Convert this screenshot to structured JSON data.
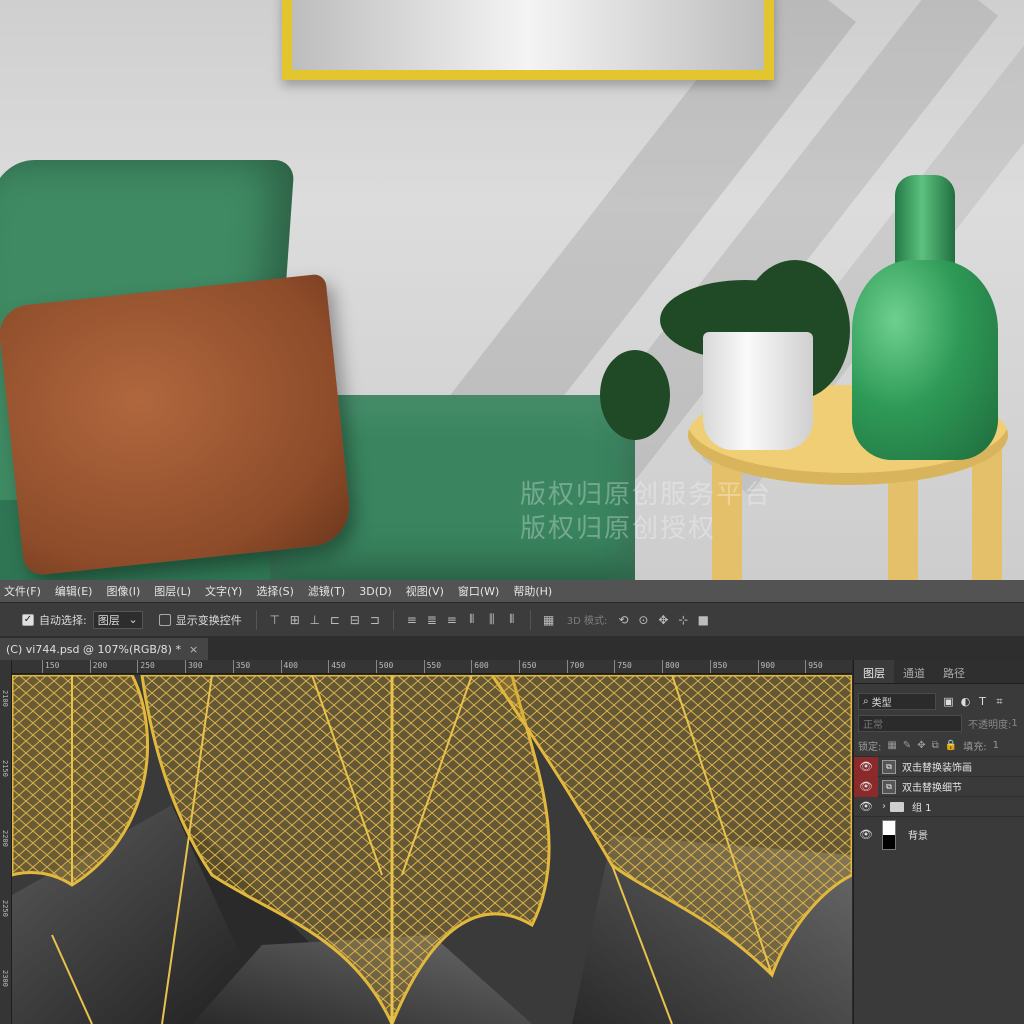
{
  "menu": [
    "文件(F)",
    "编辑(E)",
    "图像(I)",
    "图层(L)",
    "文字(Y)",
    "选择(S)",
    "滤镜(T)",
    "3D(D)",
    "视图(V)",
    "窗口(W)",
    "帮助(H)"
  ],
  "options": {
    "auto_select_label": "自动选择:",
    "auto_select_value": "图层",
    "show_transform_label": "显示变换控件",
    "mode_3d_label": "3D 模式:"
  },
  "document_tab": {
    "title": "(C) vi744.psd @ 107%(RGB/8) *",
    "close": "×"
  },
  "ruler": {
    "h_labels": [
      "150",
      "200",
      "250",
      "300",
      "350",
      "400",
      "450",
      "500",
      "550",
      "600",
      "650",
      "700",
      "750",
      "800",
      "850",
      "900",
      "950"
    ],
    "v_labels": [
      "2100",
      "2150",
      "2200",
      "2250",
      "2300"
    ]
  },
  "watermark": [
    "版权归原创服务平台",
    "版权归原创授权"
  ],
  "layers_panel": {
    "tabs": [
      "图层",
      "通道",
      "路径"
    ],
    "filter": "类型",
    "blend_mode": "正常",
    "opacity_label": "不透明度:",
    "opacity_value": "1",
    "lock_label": "锁定:",
    "fill_label": "填充:",
    "fill_value": "1",
    "layers": [
      {
        "name": "双击替换装饰画",
        "type": "smart-object",
        "highlight": true
      },
      {
        "name": "双击替换细节",
        "type": "smart-object",
        "highlight": true
      },
      {
        "name": "组 1",
        "type": "group",
        "highlight": false
      },
      {
        "name": "背景",
        "type": "background",
        "highlight": false
      }
    ]
  },
  "colors": {
    "accent_gold": "#d4a82a",
    "panel_bg": "#3a3a3a",
    "menu_bg": "#535353",
    "eye_highlight": "#8a2a2a"
  }
}
